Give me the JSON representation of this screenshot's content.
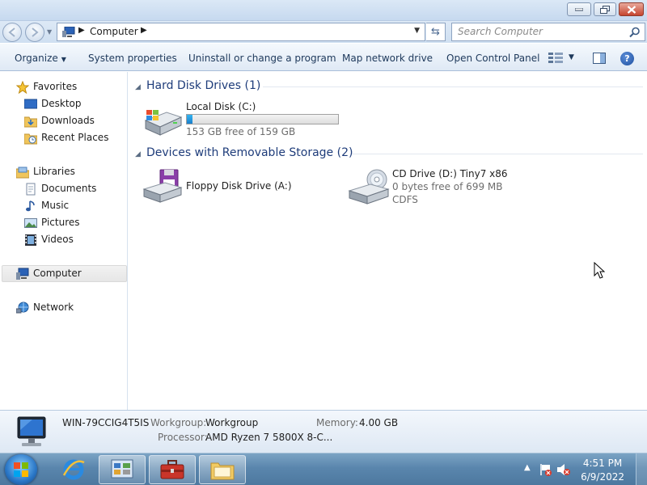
{
  "window": {
    "address": {
      "crumb": "Computer"
    },
    "search": {
      "placeholder": "Search Computer"
    }
  },
  "toolbar": {
    "organize": "Organize",
    "system_properties": "System properties",
    "uninstall": "Uninstall or change a program",
    "map_drive": "Map network drive",
    "control_panel": "Open Control Panel"
  },
  "sidebar": {
    "favorites": "Favorites",
    "desktop": "Desktop",
    "downloads": "Downloads",
    "recent_places": "Recent Places",
    "libraries": "Libraries",
    "documents": "Documents",
    "music": "Music",
    "pictures": "Pictures",
    "videos": "Videos",
    "computer": "Computer",
    "network": "Network"
  },
  "groups": {
    "hdd": {
      "title": "Hard Disk Drives (1)"
    },
    "removable": {
      "title": "Devices with Removable Storage (2)"
    }
  },
  "drives": {
    "c": {
      "name": "Local Disk (C:)",
      "free": "153 GB free of 159 GB",
      "used_fraction": 0.038
    },
    "a": {
      "name": "Floppy Disk Drive (A:)"
    },
    "d": {
      "name": "CD Drive (D:) Tiny7 x86",
      "free": "0 bytes free of 699 MB",
      "fs": "CDFS"
    }
  },
  "details": {
    "computer_name": "WIN-79CCIG4T5IS",
    "workgroup_label": "Workgroup:",
    "workgroup_value": "Workgroup",
    "memory_label": "Memory:",
    "memory_value": "4.00 GB",
    "processor_label": "Processor:",
    "processor_value": "AMD Ryzen 7 5800X 8-C..."
  },
  "taskbar": {
    "time": "4:51 PM",
    "date": "6/9/2022"
  },
  "colors": {
    "accent": "#1e3c7a",
    "progress": "#1a7fcb",
    "taskbar": "#5a86ad"
  }
}
